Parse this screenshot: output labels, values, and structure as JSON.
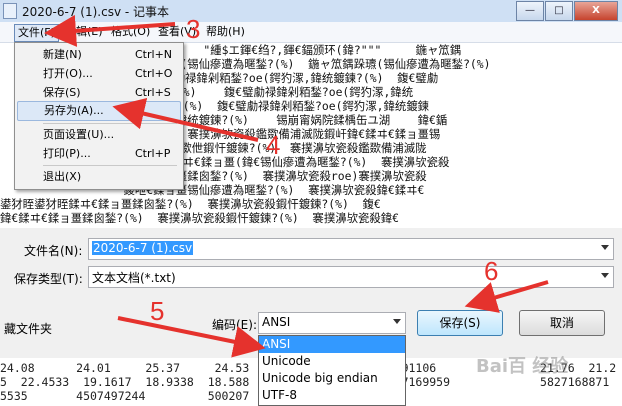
{
  "window": {
    "title": "2020-6-7 (1).csv - 记事本"
  },
  "window_buttons": [
    "—",
    "□",
    "X"
  ],
  "menubar": {
    "file": "文件(F)",
    "edit": "编辑(E)",
    "format": "格式(O)",
    "view": "查看(V)",
    "help": "帮助(H)"
  },
  "file_menu": {
    "new": {
      "label": "新建(N)",
      "shortcut": "Ctrl+N"
    },
    "open": {
      "label": "打开(O)...",
      "shortcut": "Ctrl+O"
    },
    "save": {
      "label": "保存(S)",
      "shortcut": "Ctrl+S"
    },
    "save_as": {
      "label": "另存为(A)..."
    },
    "page_setup": {
      "label": "页面设置(U)..."
    },
    "print": {
      "label": "打印(P)...",
      "shortcut": "Ctrl+P"
    },
    "exit": {
      "label": "退出(X)"
    }
  },
  "editor_lines": [
    "                  鍏?\"\"\"      \"緟$エ鍕€绉?,鍕€鍢颁环(鍏?\"\"\"     鍦ャ笟鍝",
    "                  ャ笟鍝跺瓙(锡仙瘮遭為暱鍫?(%)  鍦ャ笟鍝跺瓙(锡仙瘮遭為暱鍫?(%)",
    "                    \"鍑€璧勮禄鍏剁粨鍫?oe(鍔犳潈,鍏统鍍鍊?(%)  鍑€璧勮",
    "                  鍏剁粨鍫?(%)    鍑€璧勮禄鍏剁粨鍫?oe(鍔犳潈,鍏统",
    "                  ,鍏统鍍鍊?(%)  鍑€璧勮禄鍏剁粨鍫?oe(鍔犳潈,鍏统鍍鍊",
    "               器oe(鍔犳潈,鍏统鍍鍊?(%)    锡崩甯娲院鍒楀缶ユ湖    鍏€鍎",
    "                  暱鍫?(%)  褰撲濞欤瓷殺鑑欼備浦滅陇鍜屽鍏€鍒ヰ€鍒ョ畺锡",
    "                  鈥鏉欼伳鏉欼伳鍜忓鍍鍊?(%)  褰撲濞欤瓷殺鑑欼備浦滅陇",
    "               鍒ュ煡鍧鍍鍊鍒ヰ€鍒ョ畺(鍏€锡仙瘮遭為暱鍫?(%)  褰撲濞欤瓷殺",
    "                  鍒ヰ€鍒ョ畺鍒囪鍫?(%)  褰撲濞欤瓷殺roe)褰撲濞欤瓷殺",
    "                  鍐呭€鍒ョ畺锡仙瘮遭為暱鍫?(%)  褰撲濞欤瓷殺鍏€鍒ヰ€",
    "鍙犲眰鍙犲眰鍒ヰ€鍒ョ畺鍒囪鍫?(%)  褰撲濞欤瓷殺鍜忓鍍鍊?(%)  鍑€",
    "鍏€鍒ヰ€鍒ョ畺鍒囪鍫?(%)  褰撲濞欤瓷殺鍜忓鍍鍊?(%)  褰撲濞欤瓷殺鍏€"
  ],
  "dialog": {
    "filename_label": "文件名(N):",
    "filename_value": "2020-6-7 (1).csv",
    "filetype_label": "保存类型(T):",
    "filetype_value": "文本文档(*.txt)",
    "hide_folders": "藏文件夹",
    "encoding_label": "编码(E):",
    "encoding_value": "ANSI",
    "save_button": "保存(S)",
    "cancel_button": "取消"
  },
  "encoding_options": [
    "ANSI",
    "Unicode",
    "Unicode big endian",
    "UTF-8"
  ],
  "data_rows": [
    "24.08      24.01     25.37     24.53                    0091106               21.76  21.2",
    "5  22.4533  19.1617  18.9338  18.588                    627169959             5827168871",
    "5535       4507497244         500207"
  ],
  "annotations": {
    "n3": "3",
    "n4": "4",
    "n5": "5",
    "n6": "6"
  },
  "watermark": "Bai百 经验",
  "colors": {
    "accent_red": "#e5322d",
    "selection_blue": "#3399ff"
  }
}
